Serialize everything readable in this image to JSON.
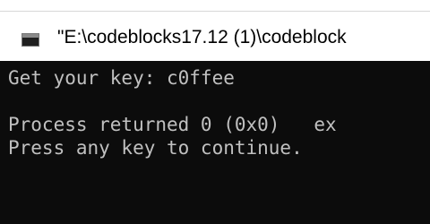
{
  "window": {
    "title": "\"E:\\codeblocks17.12 (1)\\codeblock",
    "icon": "console-app-icon"
  },
  "console": {
    "lines": [
      "Get your key: c0ffee",
      "",
      "Process returned 0 (0x0)   ex",
      "Press any key to continue."
    ],
    "cursor": "_"
  }
}
